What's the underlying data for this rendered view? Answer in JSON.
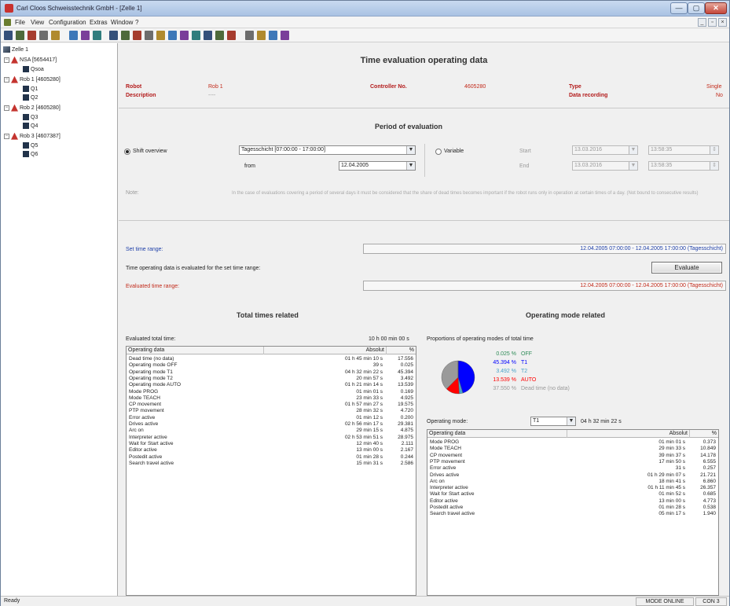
{
  "window": {
    "title": "Carl Cloos Schweisstechnik GmbH - [Zelle 1]",
    "controls": {
      "minimize": "—",
      "maximize": "▢",
      "close": "✕"
    }
  },
  "menu": {
    "items": [
      "File",
      "View",
      "Configuration",
      "Extras",
      "Window",
      "?"
    ],
    "mdi_controls": [
      "_",
      "▫",
      "×"
    ]
  },
  "toolbar": {
    "icons": [
      "save-icon",
      "print-icon",
      "cut-icon",
      "copy-icon",
      "open-icon",
      "settings-icon",
      "search-icon",
      "export-icon",
      "robot-icon",
      "robot-icon",
      "robot-icon",
      "robot-icon",
      "robot-icon",
      "robot-icon",
      "robot-icon",
      "chart-icon",
      "chart-icon",
      "chart-icon",
      "chart-icon",
      "globe-icon",
      "pointer-icon",
      "report-icon",
      "help-icon"
    ]
  },
  "tree": {
    "root": "Zelle 1",
    "nodes": [
      {
        "label": "NSA [5654417]",
        "type": "robot",
        "children": [
          "Qsoa"
        ]
      },
      {
        "label": "Rob 1 [4605280]",
        "type": "robot",
        "children": [
          "Q1",
          "Q2"
        ]
      },
      {
        "label": "Rob 2 [4605280]",
        "type": "robot",
        "children": [
          "Q3",
          "Q4"
        ]
      },
      {
        "label": "Rob 3 [4607387]",
        "type": "robot",
        "children": [
          "Q5",
          "Q6"
        ]
      }
    ]
  },
  "header": {
    "title": "Time evaluation operating data",
    "robot_label": "Robot",
    "robot_value": "Rob 1",
    "description_label": "Description",
    "description_value": "----",
    "controller_label": "Controller No.",
    "controller_value": "4605280",
    "type_label": "Type",
    "type_value": "Single",
    "data_recording_label": "Data recording",
    "data_recording_value": "No"
  },
  "period": {
    "title": "Period of evaluation",
    "shift_label": "Shift overview",
    "shift_value": "Tagesschicht [07:00:00 - 17:00:00]",
    "from_label": "from",
    "from_value": "12.04.2005",
    "variable_label": "Variable",
    "start_label": "Start",
    "start_date": "13.03.2016",
    "start_time": "13:58:35",
    "end_label": "End",
    "end_date": "13.03.2016",
    "end_time": "13:58:35",
    "note_label": "Note:",
    "note_text": "In the case of evaluations covering a period of several days it must be considered that the share of dead times becomes important if the robot runs only in operation at certain times of a day. (Not bound to consecutive results)"
  },
  "range": {
    "set_label": "Set time range:",
    "set_value": "12.04.2005 07:00:00 - 12.04.2005 17:00:00 (Tagesschicht)",
    "info_text": "Time operating data is evaluated for the set time range:",
    "evaluate_button": "Evaluate",
    "evaluated_label": "Evaluated time range:",
    "evaluated_value": "12.04.2005 07:00:00 - 12.04.2005 17:00:00 (Tagesschicht)"
  },
  "total": {
    "title": "Total times related",
    "evaluated_label": "Evaluated total time:",
    "evaluated_value": "10 h 00 min 00 s",
    "col_data": "Operating data",
    "col_absolut": "Absolut",
    "col_pct": "%",
    "rows": [
      {
        "name": "Dead time (no data)",
        "abs": "01 h 45 min 10 s",
        "pct": "17.556"
      },
      {
        "name": "Operating mode OFF",
        "abs": "39 s",
        "pct": "0.025"
      },
      {
        "name": "Operating mode T1",
        "abs": "04 h 32 min 22 s",
        "pct": "45.394"
      },
      {
        "name": "Operating mode T2",
        "abs": "20 min 57 s",
        "pct": "3.492"
      },
      {
        "name": "Operating mode AUTO",
        "abs": "01 h 21 min 14 s",
        "pct": "13.539"
      },
      {
        "name": "Mode PROG",
        "abs": "01 min 01 s",
        "pct": "0.169"
      },
      {
        "name": "Mode TEACH",
        "abs": "23 min 33 s",
        "pct": "4.925"
      },
      {
        "name": "CP movement",
        "abs": "01 h 57 min 27 s",
        "pct": "19.575"
      },
      {
        "name": "PTP movement",
        "abs": "28 min 32 s",
        "pct": "4.720"
      },
      {
        "name": "Error active",
        "abs": "01 min 12 s",
        "pct": "0.200"
      },
      {
        "name": "Drives active",
        "abs": "02 h 56 min 17 s",
        "pct": "29.381"
      },
      {
        "name": "Arc on",
        "abs": "29 min 15 s",
        "pct": "4.875"
      },
      {
        "name": "Interpreter active",
        "abs": "02 h 53 min 51 s",
        "pct": "28.975"
      },
      {
        "name": "Wait for Start active",
        "abs": "12 min 40 s",
        "pct": "2.111"
      },
      {
        "name": "Editor active",
        "abs": "13 min 00 s",
        "pct": "2.167"
      },
      {
        "name": "Postedit active",
        "abs": "01 min 28 s",
        "pct": "0.244"
      },
      {
        "name": "Search travel active",
        "abs": "15 min 31 s",
        "pct": "2.586"
      }
    ]
  },
  "modes": {
    "title": "Operating mode related",
    "proportions_label": "Proportions of operating modes of total time",
    "legend": [
      {
        "pct": "0.025 %",
        "name": "OFF",
        "color": "#2e8b57"
      },
      {
        "pct": "45.394 %",
        "name": "T1",
        "color": "#0000ff"
      },
      {
        "pct": "3.492 %",
        "name": "T2",
        "color": "#4aa3c8"
      },
      {
        "pct": "13.539 %",
        "name": "AUTO",
        "color": "#ff0000"
      },
      {
        "pct": "37.550 %",
        "name": "Dead time (no data)",
        "color": "#9a9a9a"
      }
    ],
    "mode_label": "Operating mode:",
    "mode_value": "T1",
    "mode_time": "04 h 32 min 22 s",
    "col_data": "Operating data",
    "col_absolut": "Absolut",
    "col_pct": "%",
    "rows": [
      {
        "name": "Mode PROG",
        "abs": "01 min 01 s",
        "pct": "0.373"
      },
      {
        "name": "Mode TEACH",
        "abs": "29 min 33 s",
        "pct": "10.849"
      },
      {
        "name": "CP movement",
        "abs": "39 min 37 s",
        "pct": "14.178"
      },
      {
        "name": "PTP movement",
        "abs": "17 min 50 s",
        "pct": "6.555"
      },
      {
        "name": "Error active",
        "abs": "31 s",
        "pct": "0.257"
      },
      {
        "name": "Drives active",
        "abs": "01 h 29 min 07 s",
        "pct": "21.721"
      },
      {
        "name": "Arc on",
        "abs": "18 min 41 s",
        "pct": "6.860"
      },
      {
        "name": "Interpreter active",
        "abs": "01 h 11 min 45 s",
        "pct": "26.357"
      },
      {
        "name": "Wait for Start active",
        "abs": "01 min 52 s",
        "pct": "0.685"
      },
      {
        "name": "Editor active",
        "abs": "13 min 00 s",
        "pct": "4.773"
      },
      {
        "name": "Postedit active",
        "abs": "01 min 28 s",
        "pct": "0.538"
      },
      {
        "name": "Search travel active",
        "abs": "05 min 17 s",
        "pct": "1.940"
      }
    ]
  },
  "status": {
    "left": "Ready",
    "mode": "MODE ONLINE",
    "con": "CON 3"
  }
}
